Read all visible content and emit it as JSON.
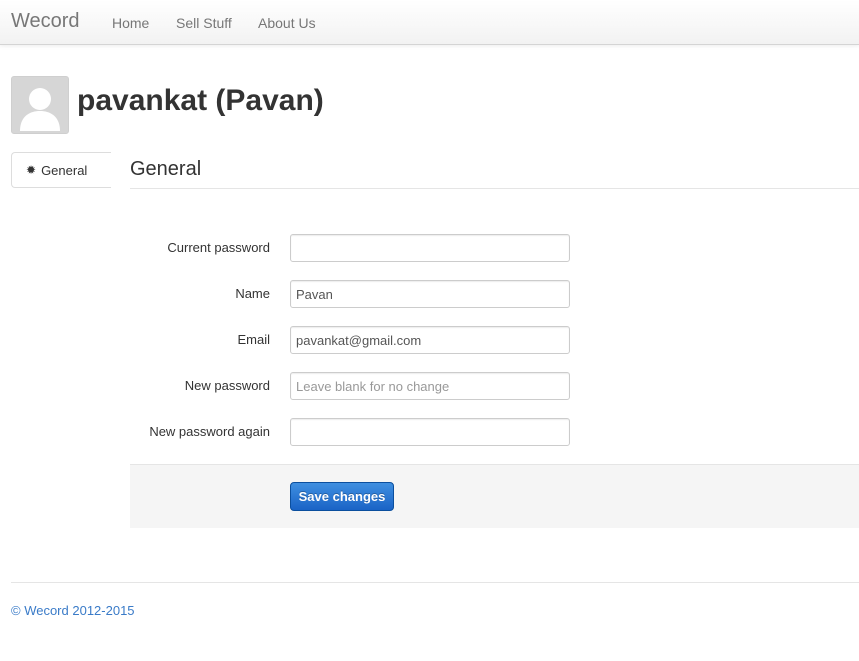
{
  "navbar": {
    "brand": "Wecord",
    "links": [
      {
        "label": "Home"
      },
      {
        "label": "Sell Stuff"
      },
      {
        "label": "About Us"
      }
    ]
  },
  "profile": {
    "title": "pavankat (Pavan)",
    "avatar_icon": "default-user-avatar"
  },
  "sidebar": {
    "items": [
      {
        "label": "General",
        "icon": "gear-icon",
        "active": true
      }
    ]
  },
  "section": {
    "title": "General"
  },
  "form": {
    "fields": [
      {
        "label": "Current password",
        "value": "",
        "placeholder": ""
      },
      {
        "label": "Name",
        "value": "Pavan",
        "placeholder": ""
      },
      {
        "label": "Email",
        "value": "pavankat@gmail.com",
        "placeholder": ""
      },
      {
        "label": "New password",
        "value": "",
        "placeholder": "Leave blank for no change"
      },
      {
        "label": "New password again",
        "value": "",
        "placeholder": ""
      }
    ],
    "save_label": "Save changes"
  },
  "footer": {
    "text": "© Wecord 2012-2015"
  },
  "colors": {
    "primary_button": "#1a63c6",
    "footer_link": "#3a7bc8",
    "nav_text": "#777777"
  }
}
